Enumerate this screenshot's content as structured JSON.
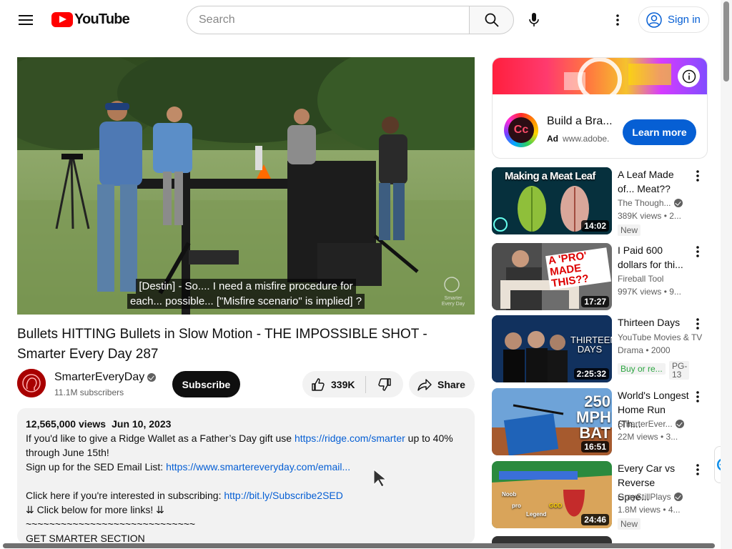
{
  "header": {
    "logo_text": "YouTube",
    "search_placeholder": "Search",
    "signin_label": "Sign in"
  },
  "player": {
    "caption_line1": "[Destin] - So.... I need a misfire procedure for",
    "caption_line2": "each... possible... [\"Misfire scenario\" is implied] ?",
    "watermark": "Smarter Every Day"
  },
  "video": {
    "title": "Bullets HITTING Bullets in Slow Motion - THE IMPOSSIBLE SHOT - Smarter Every Day 287",
    "channel_name": "SmarterEveryDay",
    "subscribers": "11.1M subscribers",
    "subscribe_label": "Subscribe",
    "likes": "339K",
    "share_label": "Share"
  },
  "description": {
    "views": "12,565,000 views",
    "date": "Jun 10, 2023",
    "line1_pre": "If you'd like to give a Ridge Wallet as a Father’s Day gift use ",
    "line1_link": "https://ridge.com/smarter",
    "line1_post": " up to 40%",
    "line2": "through June 15th!",
    "line3_pre": "Sign up for the SED Email List: ",
    "line3_link": "https://www.smartereveryday.com/email...",
    "line5_pre": "Click here if you're interested in subscribing: ",
    "line5_link": "http://bit.ly/Subscribe2SED",
    "line6": "⇊ Click below for more links! ⇊",
    "line7": "~~~~~~~~~~~~~~~~~~~~~~~~~~~~~",
    "line8": "GET SMARTER SECTION"
  },
  "ad": {
    "title": "Build a Bra...",
    "label": "Ad",
    "domain": "www.adobe.",
    "cta": "Learn more"
  },
  "recommendations": [
    {
      "title": "A Leaf Made of... Meat??",
      "channel": "The Though...",
      "stats": "389K views • 2...",
      "badge": "New",
      "duration": "14:02",
      "thumb_text": "Making a Meat Leaf",
      "verified": true
    },
    {
      "title": "I Paid 600 dollars for thi...",
      "channel": "Fireball Tool",
      "stats": "997K views • 9...",
      "badge": "",
      "duration": "17:27",
      "thumb_text": "A 'PRO' MADE THIS??",
      "verified": false
    },
    {
      "title": "Thirteen Days",
      "channel": "YouTube Movies & TV",
      "stats": "Drama • 2000",
      "badge": "Buy or re...",
      "badge2": "PG-13",
      "duration": "2:25:32",
      "thumb_text": "THIRTEEN DAYS",
      "verified": false
    },
    {
      "title": "World's Longest Home Run (Th...",
      "channel": "SmarterEver...",
      "stats": "22M views • 3...",
      "badge": "",
      "duration": "16:51",
      "thumb_text": "250 MPH BAT",
      "verified": true
    },
    {
      "title": "Every Car vs Reverse Spee...",
      "channel": "GrayStillPlays",
      "stats": "1.8M views • 4...",
      "badge": "New",
      "duration": "24:46",
      "thumb_text": "",
      "verified": true
    }
  ],
  "thumb_labels": {
    "r4_a": "Noob",
    "r4_b": "pro",
    "r4_c": "Legend",
    "r4_d": "GOD"
  }
}
